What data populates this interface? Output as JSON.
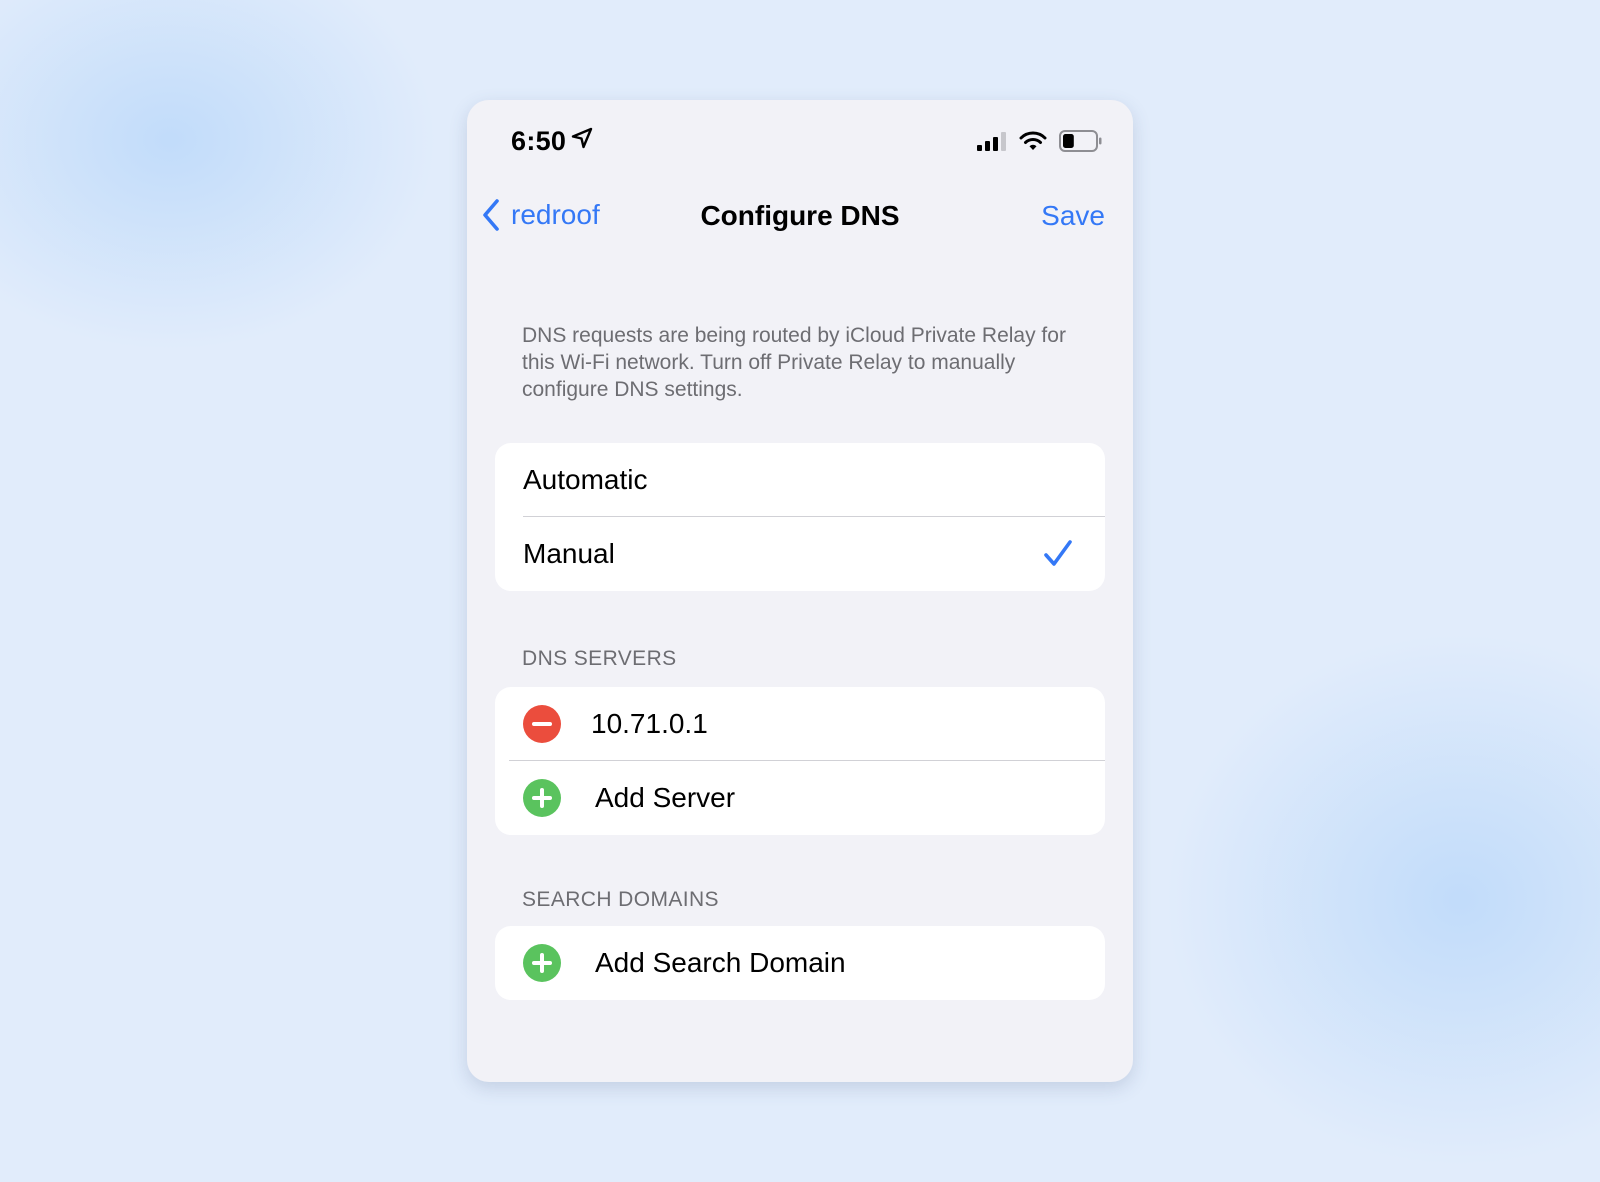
{
  "status_bar": {
    "time": "6:50",
    "icons": [
      "location-arrow-icon",
      "cellular-signal-icon",
      "wifi-icon",
      "battery-icon"
    ],
    "battery_level": 0.35
  },
  "nav": {
    "back_label": "redroof",
    "title": "Configure DNS",
    "save_label": "Save"
  },
  "info_text": "DNS requests are being routed by iCloud Private Relay for this Wi-Fi network. Turn off Private Relay to manually configure DNS settings.",
  "mode_options": [
    {
      "label": "Automatic",
      "selected": false
    },
    {
      "label": "Manual",
      "selected": true
    }
  ],
  "dns_servers": {
    "header": "DNS SERVERS",
    "servers": [
      "10.71.0.1"
    ],
    "add_label": "Add Server"
  },
  "search_domains": {
    "header": "SEARCH DOMAINS",
    "add_label": "Add Search Domain"
  },
  "colors": {
    "accent": "#3478f6",
    "remove": "#eb4d3d",
    "add": "#5ac35e",
    "background": "#f2f2f7"
  }
}
